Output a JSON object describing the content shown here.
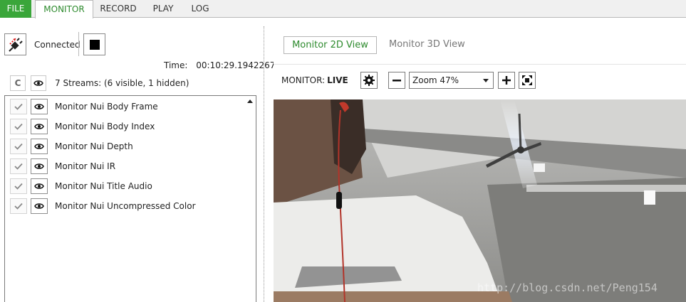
{
  "menu": {
    "file": "FILE",
    "monitor": "MONITOR",
    "record": "RECORD",
    "play": "PLAY",
    "log": "LOG"
  },
  "connection": {
    "status": "Connected",
    "icons": [
      "plug-disconnect-icon",
      "stop-icon"
    ]
  },
  "time": {
    "label": "Time:",
    "value": "00:10:29.1942267"
  },
  "streams": {
    "clear_label": "C",
    "summary": "7 Streams: (6 visible, 1 hidden)",
    "items": [
      {
        "label": "Monitor Nui Body Frame"
      },
      {
        "label": "Monitor Nui Body Index"
      },
      {
        "label": "Monitor Nui Depth"
      },
      {
        "label": "Monitor Nui IR"
      },
      {
        "label": "Monitor Nui Title Audio"
      },
      {
        "label": "Monitor Nui Uncompressed Color"
      }
    ]
  },
  "views": {
    "view_2d": "Monitor 2D View",
    "view_3d": "Monitor 3D View"
  },
  "monitor": {
    "label": "MONITOR:",
    "state": "LIVE",
    "zoom": "Zoom 47%"
  },
  "video": {
    "watermark": "http://blog.csdn.net/Peng154"
  },
  "colors": {
    "accent": "#3aa63a",
    "accent_text": "#2d8a2d"
  }
}
